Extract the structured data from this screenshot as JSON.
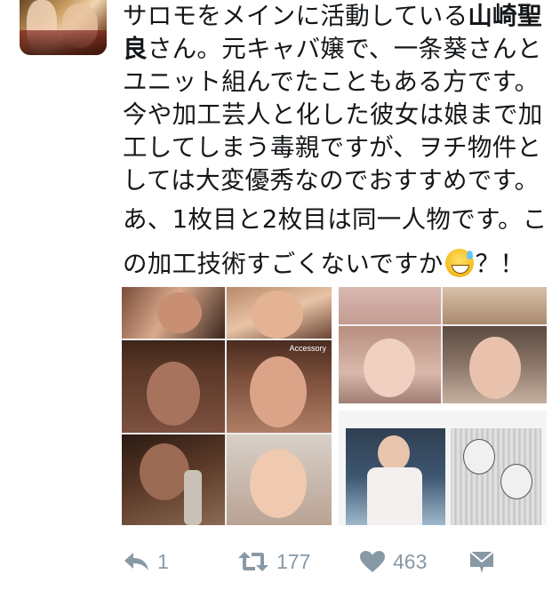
{
  "tweet": {
    "lines": [
      {
        "pre": "サロモをメインに活動している",
        "bold": "山崎聖"
      },
      {
        "bold": "良",
        "post": "さん。元キャバ嬢で、一条葵さんと"
      },
      {
        "text": "ユニット組んでたこともある方です。"
      },
      {
        "text": "今や加工芸人と化した彼女は娘まで加"
      },
      {
        "text": "工してしまう毒親ですが、ヲチ物件と"
      },
      {
        "text": "しては大変優秀なのでおすすめです。"
      },
      {
        "text": "あ、1枚目と2枚目は同一人物です。こ"
      },
      {
        "pre": "の加工技術すごくないですか",
        "post": "？！"
      }
    ],
    "emoji_icon": "grinning-sweat-emoji"
  },
  "media": {
    "photo_count": 3,
    "watermark": "Accessory"
  },
  "actions": {
    "reply_count": "1",
    "retweet_count": "177",
    "like_count": "463",
    "reply_icon": "reply-icon",
    "retweet_icon": "retweet-icon",
    "like_icon": "heart-icon",
    "dm_icon": "direct-message-icon"
  },
  "colors": {
    "text": "#14171a",
    "action_gray": "#8899a6"
  }
}
